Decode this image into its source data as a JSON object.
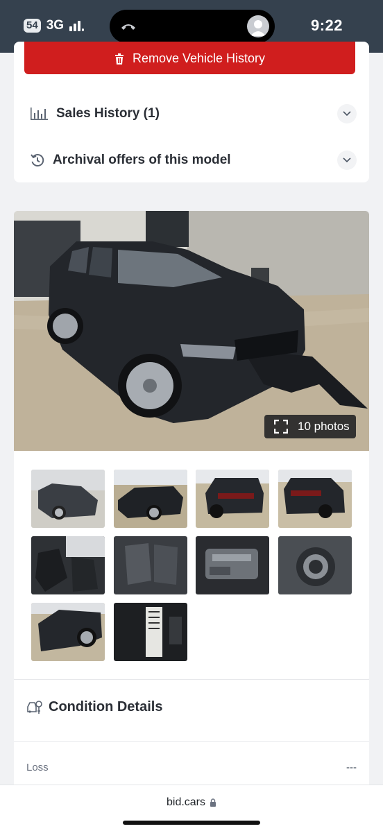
{
  "status_bar": {
    "badge": "54",
    "network": "3G",
    "time": "9:22"
  },
  "vehicle_history": {
    "remove_label": "Remove Vehicle History"
  },
  "accordions": [
    {
      "label": "Sales History (1)",
      "icon": "bar-chart-icon"
    },
    {
      "label": "Archival offers of this model",
      "icon": "history-icon"
    }
  ],
  "gallery": {
    "photos_label": "10 photos",
    "thumbnails": [
      "front-left",
      "front-damage",
      "rear-left",
      "rear-right",
      "front-seats",
      "rear-seats",
      "engine-bay",
      "interior-detail",
      "front-damage-close",
      "door-jamb-label"
    ]
  },
  "condition": {
    "title": "Condition Details",
    "loss_label": "Loss",
    "loss_value": "---"
  },
  "browser": {
    "url": "bid.cars"
  },
  "colors": {
    "remove_button": "#d01e1e",
    "status_bar": "#35414e",
    "vehicle": "#23262b"
  }
}
